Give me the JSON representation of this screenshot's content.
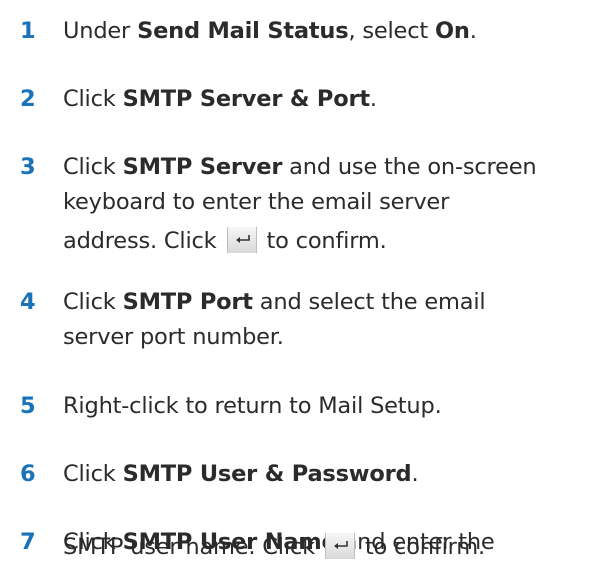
{
  "steps": [
    {
      "number": "1",
      "parts": [
        {
          "text": "Under ",
          "bold": false
        },
        {
          "text": "Send Mail Status",
          "bold": true
        },
        {
          "text": ", select ",
          "bold": false
        },
        {
          "text": "On",
          "bold": true
        },
        {
          "text": ".",
          "bold": false
        }
      ]
    },
    {
      "number": "2",
      "parts": [
        {
          "text": "Click ",
          "bold": false
        },
        {
          "text": "SMTP Server & Port",
          "bold": true
        },
        {
          "text": ".",
          "bold": false
        }
      ]
    },
    {
      "number": "3",
      "line1": [
        {
          "text": "Click ",
          "bold": false
        },
        {
          "text": "SMTP Server",
          "bold": true
        },
        {
          "text": " and use the on-screen",
          "bold": false
        }
      ],
      "line2": "keyboard to enter the email server",
      "line3_before": "address. Click",
      "line3_after": "to confirm."
    },
    {
      "number": "4",
      "line1": [
        {
          "text": "Click ",
          "bold": false
        },
        {
          "text": "SMTP Port",
          "bold": true
        },
        {
          "text": " and select the email",
          "bold": false
        }
      ],
      "line2": "server port number."
    },
    {
      "number": "5",
      "text": "Right-click to return to Mail Setup."
    },
    {
      "number": "6",
      "parts": [
        {
          "text": "Click ",
          "bold": false
        },
        {
          "text": "SMTP User & Password",
          "bold": true
        },
        {
          "text": ".",
          "bold": false
        }
      ]
    },
    {
      "number": "7",
      "line1": [
        {
          "text": "Click ",
          "bold": false
        },
        {
          "text": "SMTP User Name",
          "bold": true
        },
        {
          "text": " and enter the",
          "bold": false
        }
      ],
      "line2_before": "SMTP user name. Click",
      "line2_after": "to confirm."
    }
  ],
  "colors": {
    "step_number": "#1a72b8",
    "body_text": "#2b2b2b"
  },
  "icons": {
    "enter_key": "enter-return-icon"
  }
}
